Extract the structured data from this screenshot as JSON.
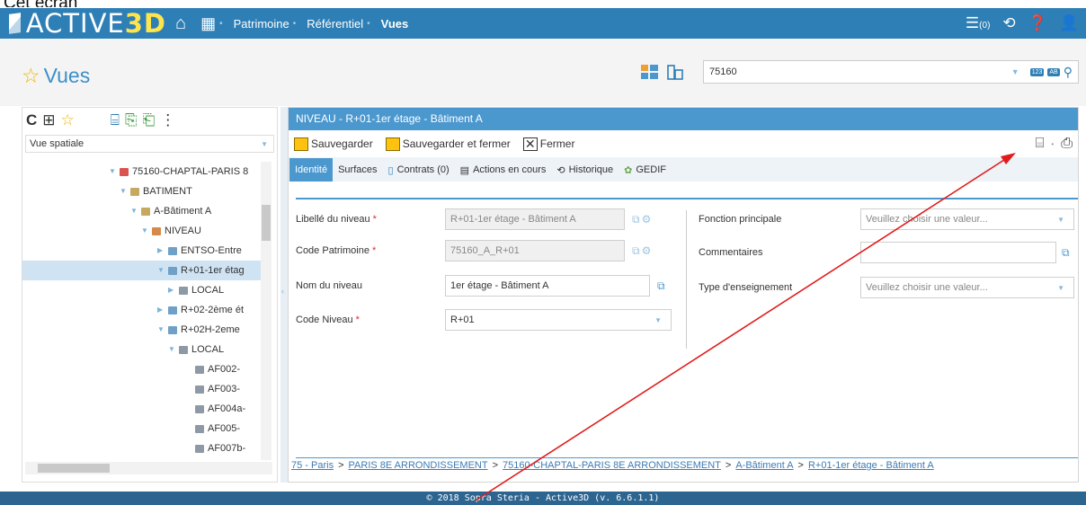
{
  "caption": "Cet écran apparaît :",
  "topbar": {
    "logo_main": "ACTIVE",
    "logo_3d": "3D",
    "nav": [
      "Patrimoine",
      "Référentiel",
      "Vues"
    ],
    "notif_count": "(0)"
  },
  "header": {
    "title": "Vues",
    "search_value": "75160",
    "mini_badges": [
      "123",
      "AB"
    ]
  },
  "left": {
    "select_value": "Vue spatiale",
    "tree": [
      {
        "label": "75160-CHAPTAL-PARIS 8",
        "toggle": "▼",
        "color": "#d9534f"
      },
      {
        "label": "BATIMENT",
        "toggle": "▼",
        "color": "#c7a860"
      },
      {
        "label": "A-Bâtiment A",
        "toggle": "▼",
        "color": "#c7a860"
      },
      {
        "label": "NIVEAU",
        "toggle": "▼",
        "color": "#d58a4c"
      },
      {
        "label": "ENTSO-Entre",
        "toggle": "▶",
        "color": "#6fa0c8"
      },
      {
        "label": "R+01-1er étag",
        "toggle": "▼",
        "color": "#6fa0c8"
      },
      {
        "label": "LOCAL",
        "toggle": "▶",
        "color": "#8d9aa6"
      },
      {
        "label": "R+02-2ème ét",
        "toggle": "▶",
        "color": "#6fa0c8"
      },
      {
        "label": "R+02H-2eme",
        "toggle": "▼",
        "color": "#6fa0c8"
      },
      {
        "label": "LOCAL",
        "toggle": "▼",
        "color": "#8d9aa6"
      },
      {
        "label": "AF002-",
        "toggle": "",
        "color": "#8d9aa6"
      },
      {
        "label": "AF003-",
        "toggle": "",
        "color": "#8d9aa6"
      },
      {
        "label": "AF004a-",
        "toggle": "",
        "color": "#8d9aa6"
      },
      {
        "label": "AF005-",
        "toggle": "",
        "color": "#8d9aa6"
      },
      {
        "label": "AF007b-",
        "toggle": "",
        "color": "#8d9aa6"
      }
    ]
  },
  "main": {
    "title": "NIVEAU - R+01-1er étage - Bâtiment A",
    "save": "Sauvegarder",
    "save_close": "Sauvegarder et fermer",
    "close": "Fermer",
    "tabs": [
      "Identité",
      "Surfaces",
      "Contrats (0)",
      "Actions en cours",
      "Historique",
      "GEDIF"
    ],
    "fields": {
      "libelle_label": "Libellé du niveau",
      "libelle_value": "R+01-1er étage - Bâtiment A",
      "code_patr_label": "Code Patrimoine",
      "code_patr_value": "75160_A_R+01",
      "nom_label": "Nom du niveau",
      "nom_value": "1er étage - Bâtiment A",
      "code_niv_label": "Code Niveau",
      "code_niv_value": "R+01",
      "fonction_label": "Fonction principale",
      "fonction_placeholder": "Veuillez choisir une valeur...",
      "comment_label": "Commentaires",
      "type_label": "Type d'enseignement",
      "type_placeholder": "Veuillez choisir une valeur..."
    },
    "breadcrumb": [
      "75 - Paris",
      "PARIS 8E ARRONDISSEMENT",
      "75160-CHAPTAL-PARIS 8E ARRONDISSEMENT",
      "A-Bâtiment A",
      "R+01-1er étage - Bâtiment A"
    ]
  },
  "footer": "© 2018 Sopra Steria - Active3D (v. 6.6.1.1)",
  "colors": {
    "brand": "#2d7fb5",
    "panel_header": "#4b98cf",
    "annotation": "#e11b1b"
  }
}
